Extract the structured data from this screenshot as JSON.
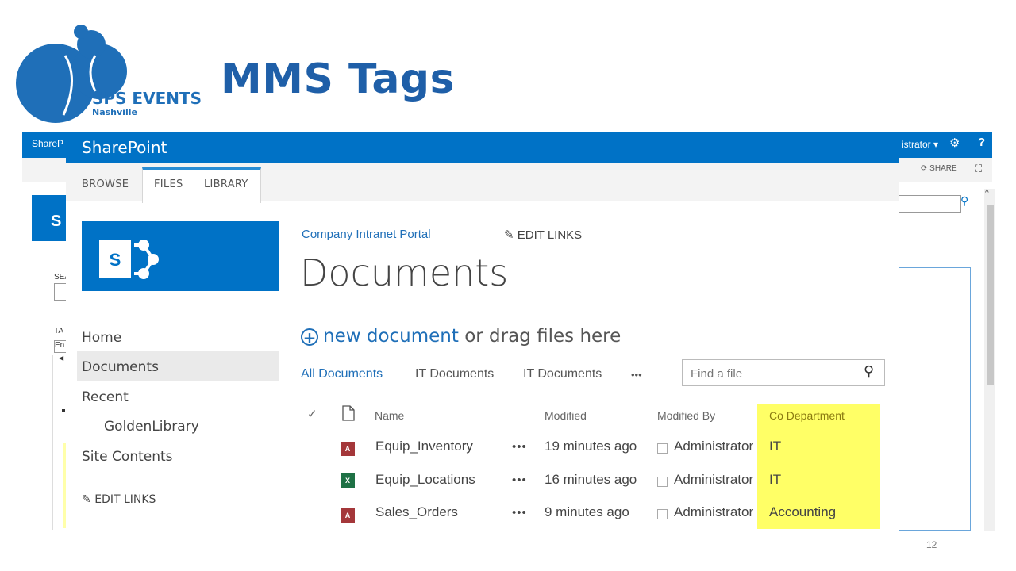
{
  "slide": {
    "title": "MMS Tags",
    "logo_line1": "SPS EVENTS",
    "logo_line2": "Nashville",
    "page_number": "12"
  },
  "background_window": {
    "bar_text": "ShareP",
    "admin_text": "istrator ▾",
    "share_label": "SHARE",
    "sea_label": "SEA",
    "ta_label": "TA",
    "en_label": "En"
  },
  "suite": {
    "title": "SharePoint"
  },
  "ribbon": {
    "tabs": [
      "BROWSE",
      "FILES",
      "LIBRARY"
    ]
  },
  "nav": {
    "items": [
      "Home",
      "Documents",
      "Recent",
      "GoldenLibrary",
      "Site Contents"
    ],
    "edit_links": "EDIT LINKS"
  },
  "header": {
    "breadcrumb": "Company Intranet Portal",
    "edit_links": "EDIT LINKS",
    "title": "Documents"
  },
  "new_doc": {
    "link": "new document",
    "rest": " or drag files here"
  },
  "views": {
    "items": [
      "All Documents",
      "IT Documents",
      "IT Documents"
    ],
    "more": "•••"
  },
  "search": {
    "placeholder": "Find a file"
  },
  "table": {
    "headers": {
      "name": "Name",
      "modified": "Modified",
      "modified_by": "Modified By",
      "dept": "Co Department"
    },
    "rows": [
      {
        "name": "Equip_Inventory",
        "modified": "19 minutes ago",
        "by": "Administrator",
        "dept": "IT",
        "type": "access"
      },
      {
        "name": "Equip_Locations",
        "modified": "16 minutes ago",
        "by": "Administrator",
        "dept": "IT",
        "type": "excel"
      },
      {
        "name": "Sales_Orders",
        "modified": "9 minutes ago",
        "by": "Administrator",
        "dept": "Accounting",
        "type": "access"
      }
    ],
    "ellipsis": "•••",
    "highlight_color": "#ffff66"
  },
  "colors": {
    "brand_blue": "#0072c6",
    "title_blue": "#1f5fa8",
    "link_blue": "#1f6fb8"
  },
  "icons": [
    "pencil-icon",
    "search-icon",
    "gear-icon",
    "help-icon",
    "share-icon",
    "focus-icon",
    "add-circle-icon",
    "checkmark-icon",
    "document-icon",
    "access-file-icon",
    "excel-file-icon"
  ]
}
